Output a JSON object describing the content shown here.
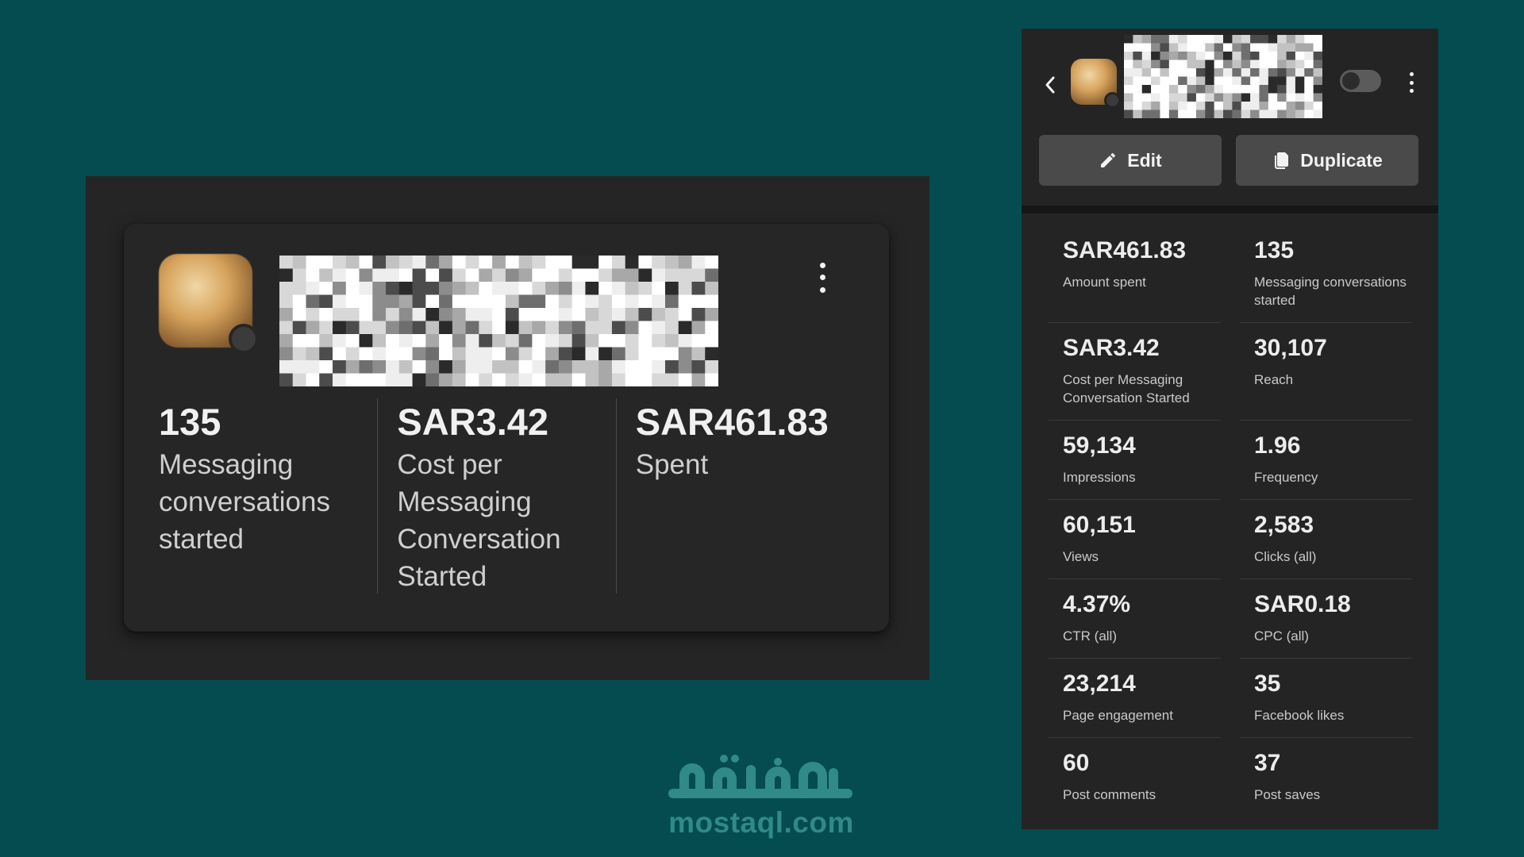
{
  "left_card": {
    "stats": [
      {
        "value": "135",
        "label": "Messaging conversations started"
      },
      {
        "value": "SAR3.42",
        "label": "Cost per Messaging Conversation Started"
      },
      {
        "value": "SAR461.83",
        "label": "Spent"
      }
    ]
  },
  "right_panel": {
    "edit_label": "Edit",
    "duplicate_label": "Duplicate",
    "toggle_on": false,
    "metrics": [
      {
        "value": "SAR461.83",
        "label": "Amount spent"
      },
      {
        "value": "135",
        "label": "Messaging conversations started"
      },
      {
        "value": "SAR3.42",
        "label": "Cost per Messaging Conversation Started"
      },
      {
        "value": "30,107",
        "label": "Reach"
      },
      {
        "value": "59,134",
        "label": "Impressions"
      },
      {
        "value": "1.96",
        "label": "Frequency"
      },
      {
        "value": "60,151",
        "label": "Views"
      },
      {
        "value": "2,583",
        "label": "Clicks (all)"
      },
      {
        "value": "4.37%",
        "label": "CTR (all)"
      },
      {
        "value": "SAR0.18",
        "label": "CPC (all)"
      },
      {
        "value": "23,214",
        "label": "Page engagement"
      },
      {
        "value": "35",
        "label": "Facebook likes"
      },
      {
        "value": "60",
        "label": "Post comments"
      },
      {
        "value": "37",
        "label": "Post saves"
      }
    ]
  },
  "icons": {
    "back": "chevron-left-icon",
    "menu": "more-vertical-icon",
    "edit": "pencil-icon",
    "duplicate": "copy-icon"
  },
  "watermark": {
    "logo_text": "مستقل",
    "url": "mostaql.com"
  },
  "colors": {
    "background": "#044c50",
    "card": "#262627",
    "button": "#4a4a4b",
    "watermark": "#2f8a88"
  }
}
